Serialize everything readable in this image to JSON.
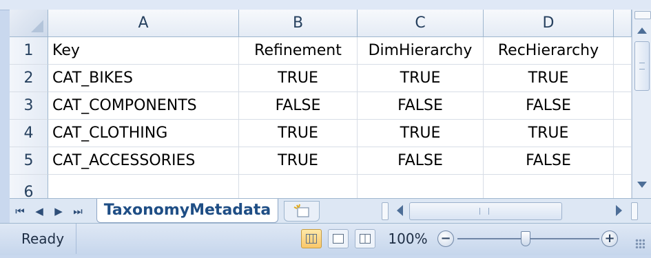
{
  "columns": [
    "A",
    "B",
    "C",
    "D"
  ],
  "rows": [
    {
      "num": "1",
      "cells": [
        "Key",
        "Refinement",
        "DimHierarchy",
        "RecHierarchy"
      ]
    },
    {
      "num": "2",
      "cells": [
        "CAT_BIKES",
        "TRUE",
        "TRUE",
        "TRUE"
      ]
    },
    {
      "num": "3",
      "cells": [
        "CAT_COMPONENTS",
        "FALSE",
        "FALSE",
        "FALSE"
      ]
    },
    {
      "num": "4",
      "cells": [
        "CAT_CLOTHING",
        "TRUE",
        "TRUE",
        "TRUE"
      ]
    },
    {
      "num": "5",
      "cells": [
        "CAT_ACCESSORIES",
        "TRUE",
        "FALSE",
        "FALSE"
      ]
    },
    {
      "num": "6",
      "cells": [
        "",
        "",
        "",
        ""
      ]
    }
  ],
  "sheet_tabs": {
    "active": "TaxonomyMetadata",
    "nav": [
      "⏮",
      "◀",
      "▶",
      "⏭"
    ],
    "new_sheet_icon": "insert-sheet-icon"
  },
  "status_bar": {
    "status": "Ready",
    "zoom": "100%",
    "zoom_out": "−",
    "zoom_in": "+",
    "view_modes": [
      "normal-view-icon",
      "page-layout-view-icon",
      "page-break-preview-icon"
    ],
    "active_view": "normal-view-icon"
  },
  "colors": {
    "header_text": "#27415f",
    "tab_text": "#1f4e85",
    "frame": "#c9d8ee"
  }
}
